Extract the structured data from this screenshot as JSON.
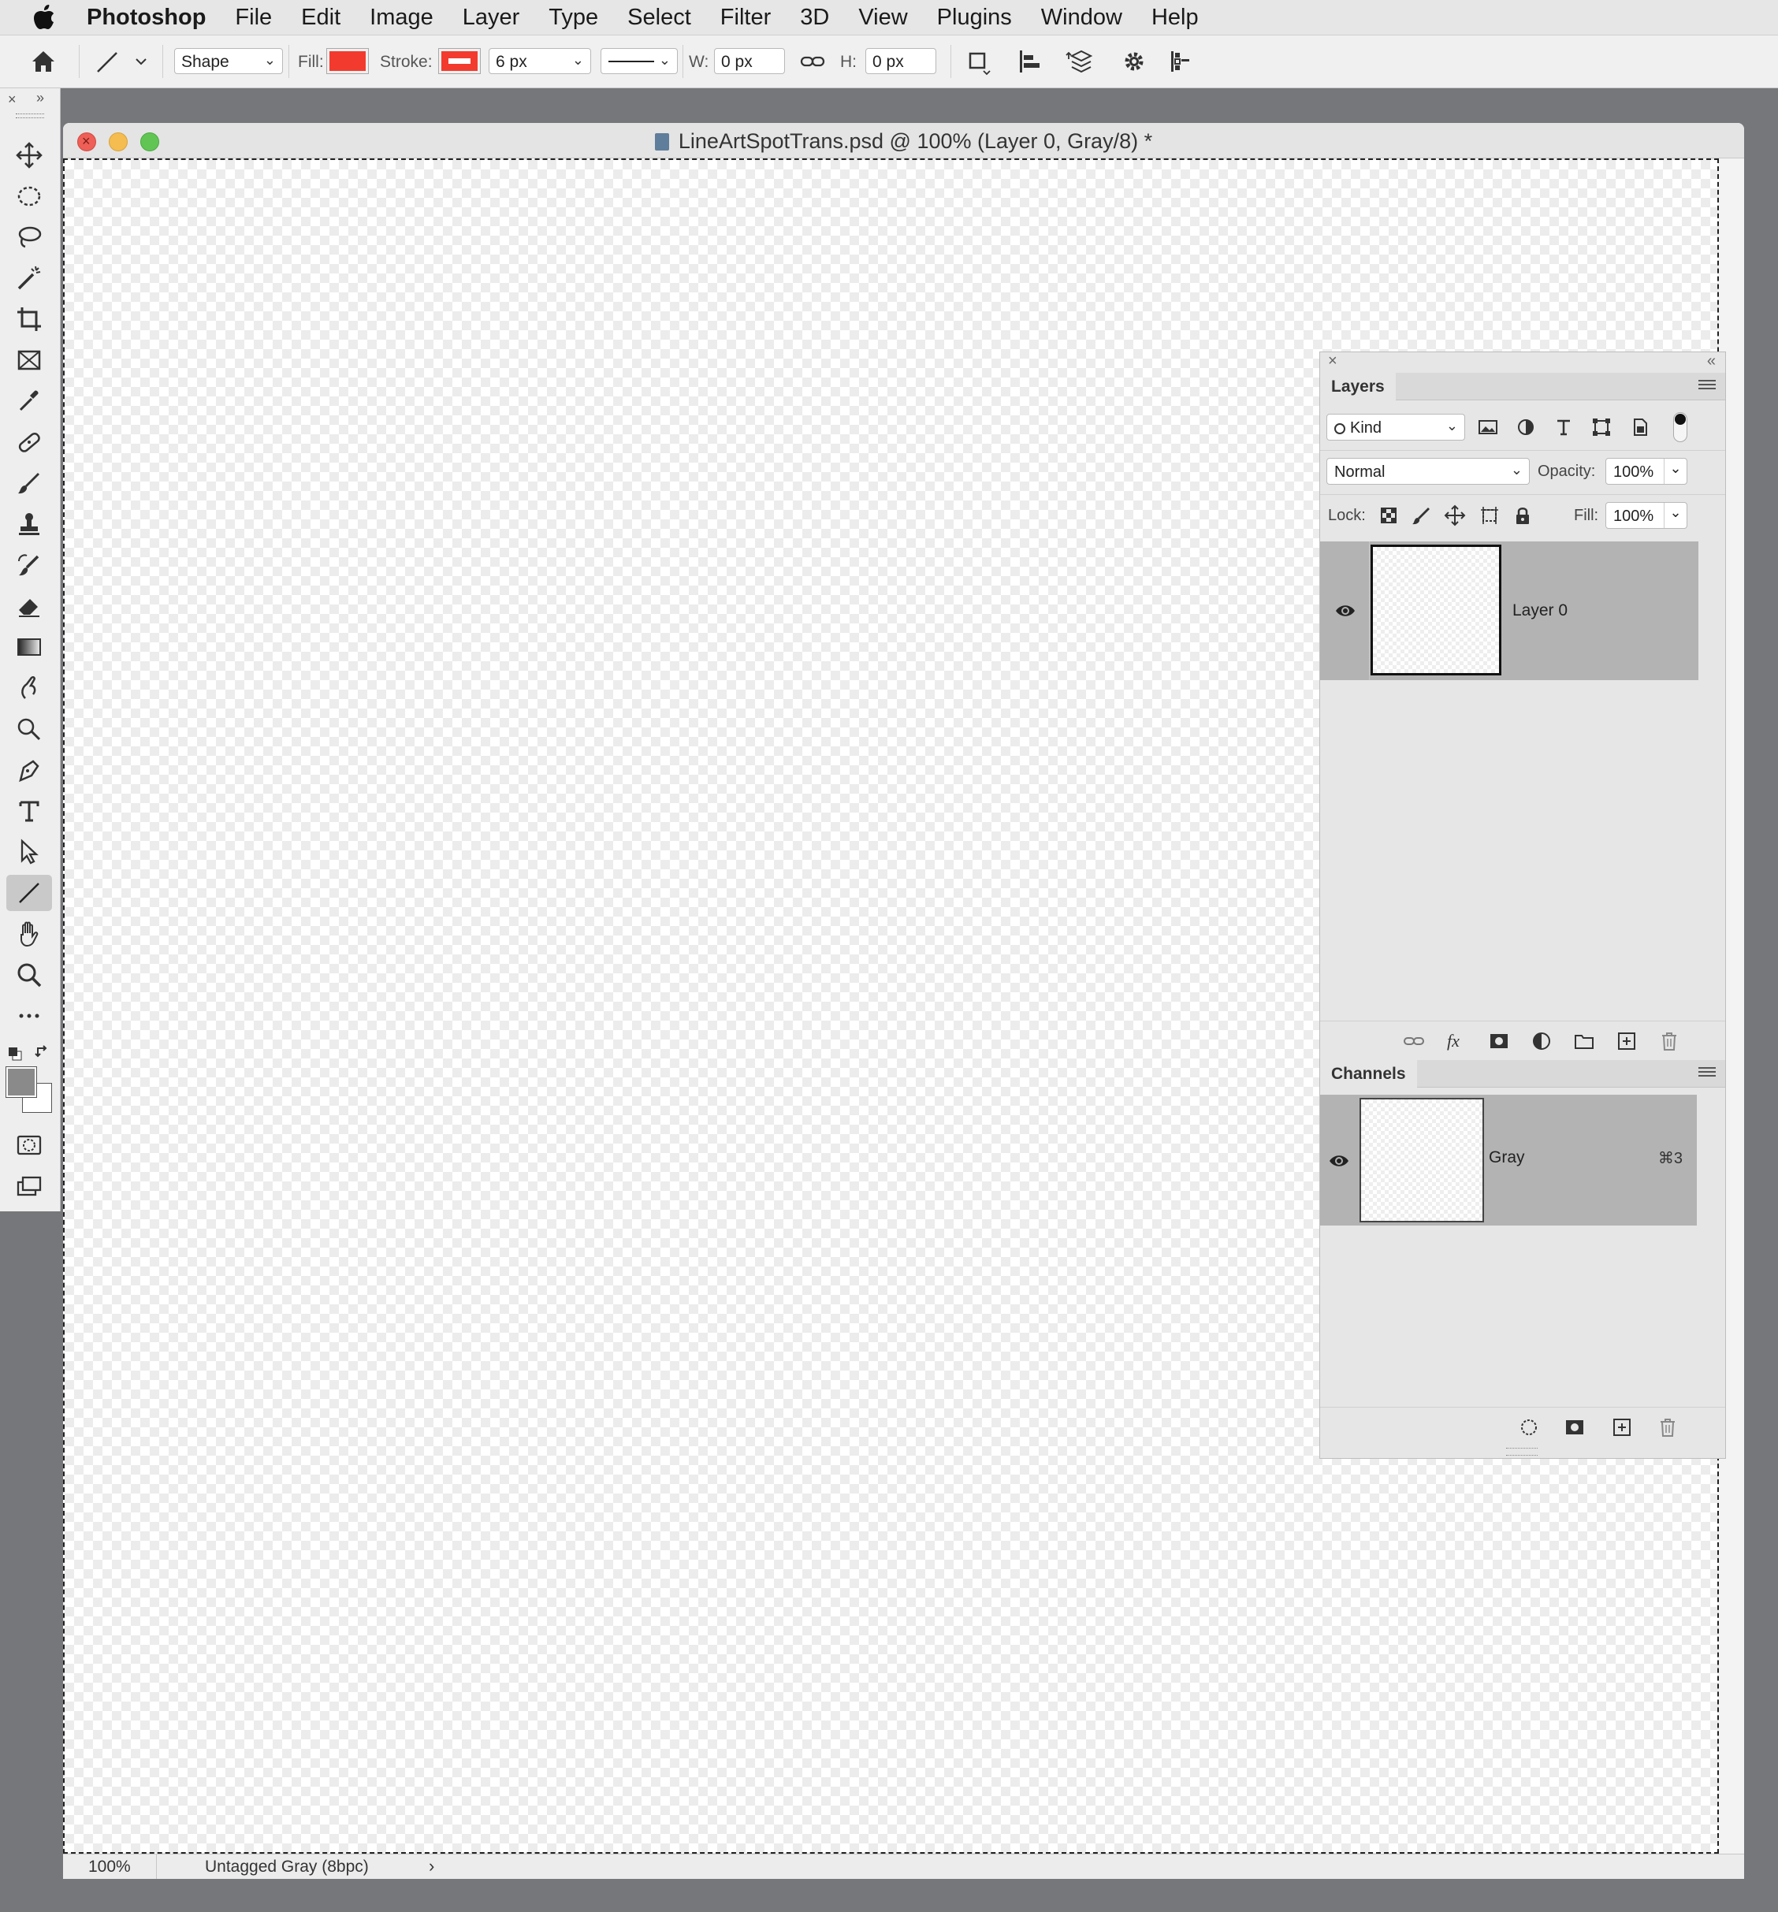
{
  "menubar": {
    "app": "Photoshop",
    "items": [
      "File",
      "Edit",
      "Image",
      "Layer",
      "Type",
      "Select",
      "Filter",
      "3D",
      "View",
      "Plugins",
      "Window",
      "Help"
    ]
  },
  "options": {
    "mode": "Shape",
    "fill_label": "Fill:",
    "fill_color": "#f33a2e",
    "stroke_label": "Stroke:",
    "stroke_color": "#f33a2e",
    "stroke_width": "6 px",
    "w_label": "W:",
    "w_value": "0 px",
    "h_label": "H:",
    "h_value": "0 px"
  },
  "toolbox": {
    "tools": [
      "move-tool",
      "elliptical-marquee-tool",
      "lasso-tool",
      "magic-wand-tool",
      "crop-tool",
      "frame-tool",
      "eyedropper-tool",
      "healing-brush-tool",
      "brush-tool",
      "clone-stamp-tool",
      "history-brush-tool",
      "eraser-tool",
      "gradient-tool",
      "blur-tool",
      "dodge-tool",
      "pen-tool",
      "type-tool",
      "path-selection-tool",
      "line-tool",
      "hand-tool",
      "zoom-tool",
      "more-tools"
    ],
    "selected": "line-tool",
    "foreground_color": "#8a8a8a",
    "background_color": "#ffffff"
  },
  "document": {
    "title": "LineArtSpotTrans.psd @ 100% (Layer 0, Gray/8) *",
    "zoom": "100%",
    "color_profile": "Untagged Gray (8bpc)"
  },
  "layers_panel": {
    "tab": "Layers",
    "filter_kind": "Kind",
    "blend_mode": "Normal",
    "opacity_label": "Opacity:",
    "opacity": "100%",
    "lock_label": "Lock:",
    "fill_label": "Fill:",
    "fill": "100%",
    "layers": [
      {
        "name": "Layer 0",
        "visible": true
      }
    ]
  },
  "channels_panel": {
    "tab": "Channels",
    "channels": [
      {
        "name": "Gray",
        "shortcut": "⌘3",
        "visible": true
      }
    ]
  }
}
